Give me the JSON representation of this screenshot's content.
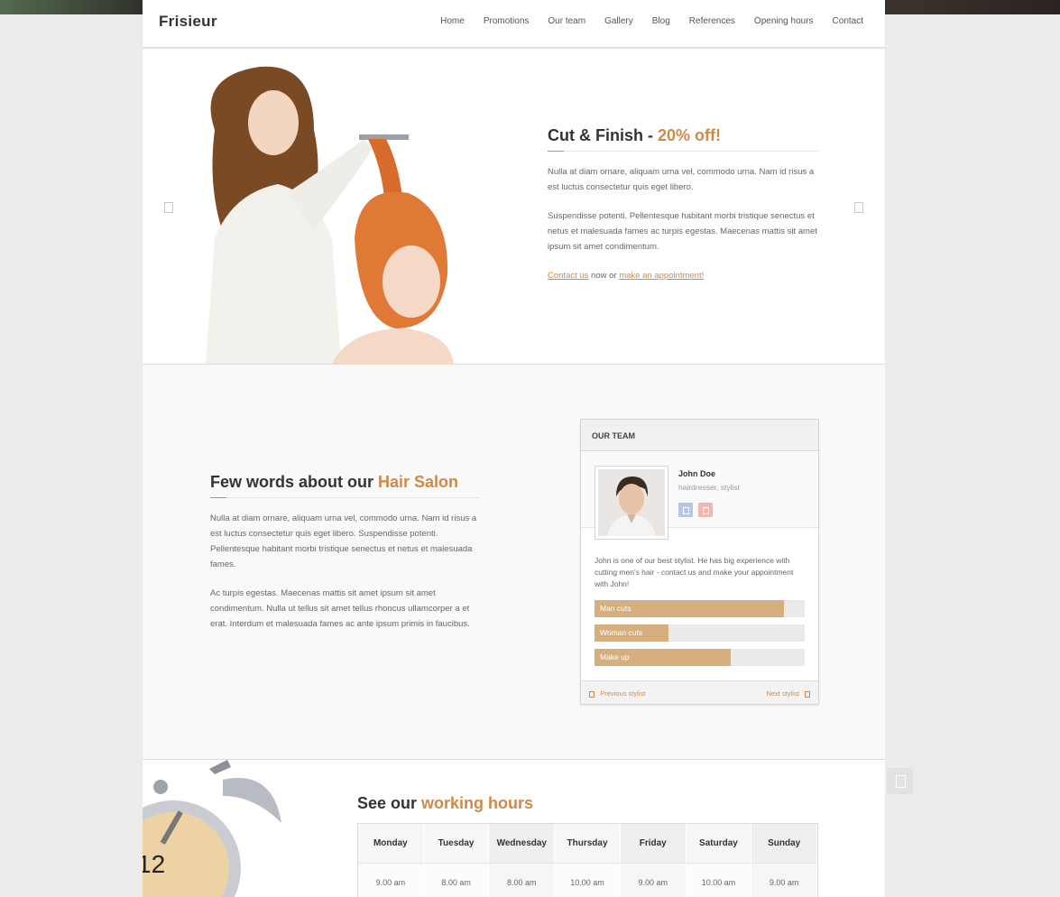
{
  "brand": {
    "logo": "Frisieur",
    "accent_color": "#cd8a48"
  },
  "nav": {
    "items": [
      "Home",
      "Promotions",
      "Our team",
      "Gallery",
      "Blog",
      "References",
      "Opening hours",
      "Contact"
    ]
  },
  "hero": {
    "title_main": "Cut & Finish - ",
    "title_accent": "20% off!",
    "paragraphs": [
      "Nulla at diam ornare, aliquam urna vel, commodo urna. Nam id risus a est luctus consectetur quis eget libero.",
      "Suspendisse potenti. Pellentesque habitant morbi tristique senectus et netus et malesuada fames ac turpis egestas. Maecenas mattis sit amet ipsum sit amet condimentum."
    ],
    "cta_link1": "Contact us",
    "cta_middle": " now or ",
    "cta_link2": "make an appointment!"
  },
  "about": {
    "title_main": "Few words about our ",
    "title_accent": "Hair Salon",
    "paragraphs": [
      "Nulla at diam ornare, aliquam urna vel, commodo urna. Nam id risus a est luctus consectetur quis eget libero. Suspendisse potenti. Pellentesque habitant morbi tristique senectus et netus et malesuada fames.",
      "Ac turpis egestas. Maecenas mattis sit amet ipsum sit amet condimentum. Nulla ut tellus sit amet tellus rhoncus ullamcorper a et erat. Interdum et malesuada fames ac ante ipsum primis in faucibus."
    ]
  },
  "team": {
    "header": "OUR TEAM",
    "member": {
      "name": "John Doe",
      "role": "hairdresser, stylist",
      "bio": "John is one of our best stylist. He has big experience with cutting men's hair - contact us and make your appointment with John!"
    },
    "skills": [
      {
        "label": "Man cuts",
        "level": 0.9
      },
      {
        "label": "Woman cuts",
        "level": 0.35
      },
      {
        "label": "Make up",
        "level": 0.65
      }
    ],
    "prev_label": "Previous stylist",
    "next_label": "Next stylist"
  },
  "hours": {
    "title_main": "See our ",
    "title_accent": "working hours",
    "days": [
      "Monday",
      "Tuesday",
      "Wednesday",
      "Thursday",
      "Friday",
      "Saturday",
      "Sunday"
    ],
    "times": [
      "9.00 am",
      "8.00 am",
      "8.00 am",
      "10.00 am",
      "9.00 am",
      "10.00 am",
      "9.00 am"
    ]
  },
  "icons": [
    "prev-arrow-icon",
    "next-arrow-icon",
    "facebook-icon",
    "google-plus-icon",
    "scroll-top-icon"
  ]
}
